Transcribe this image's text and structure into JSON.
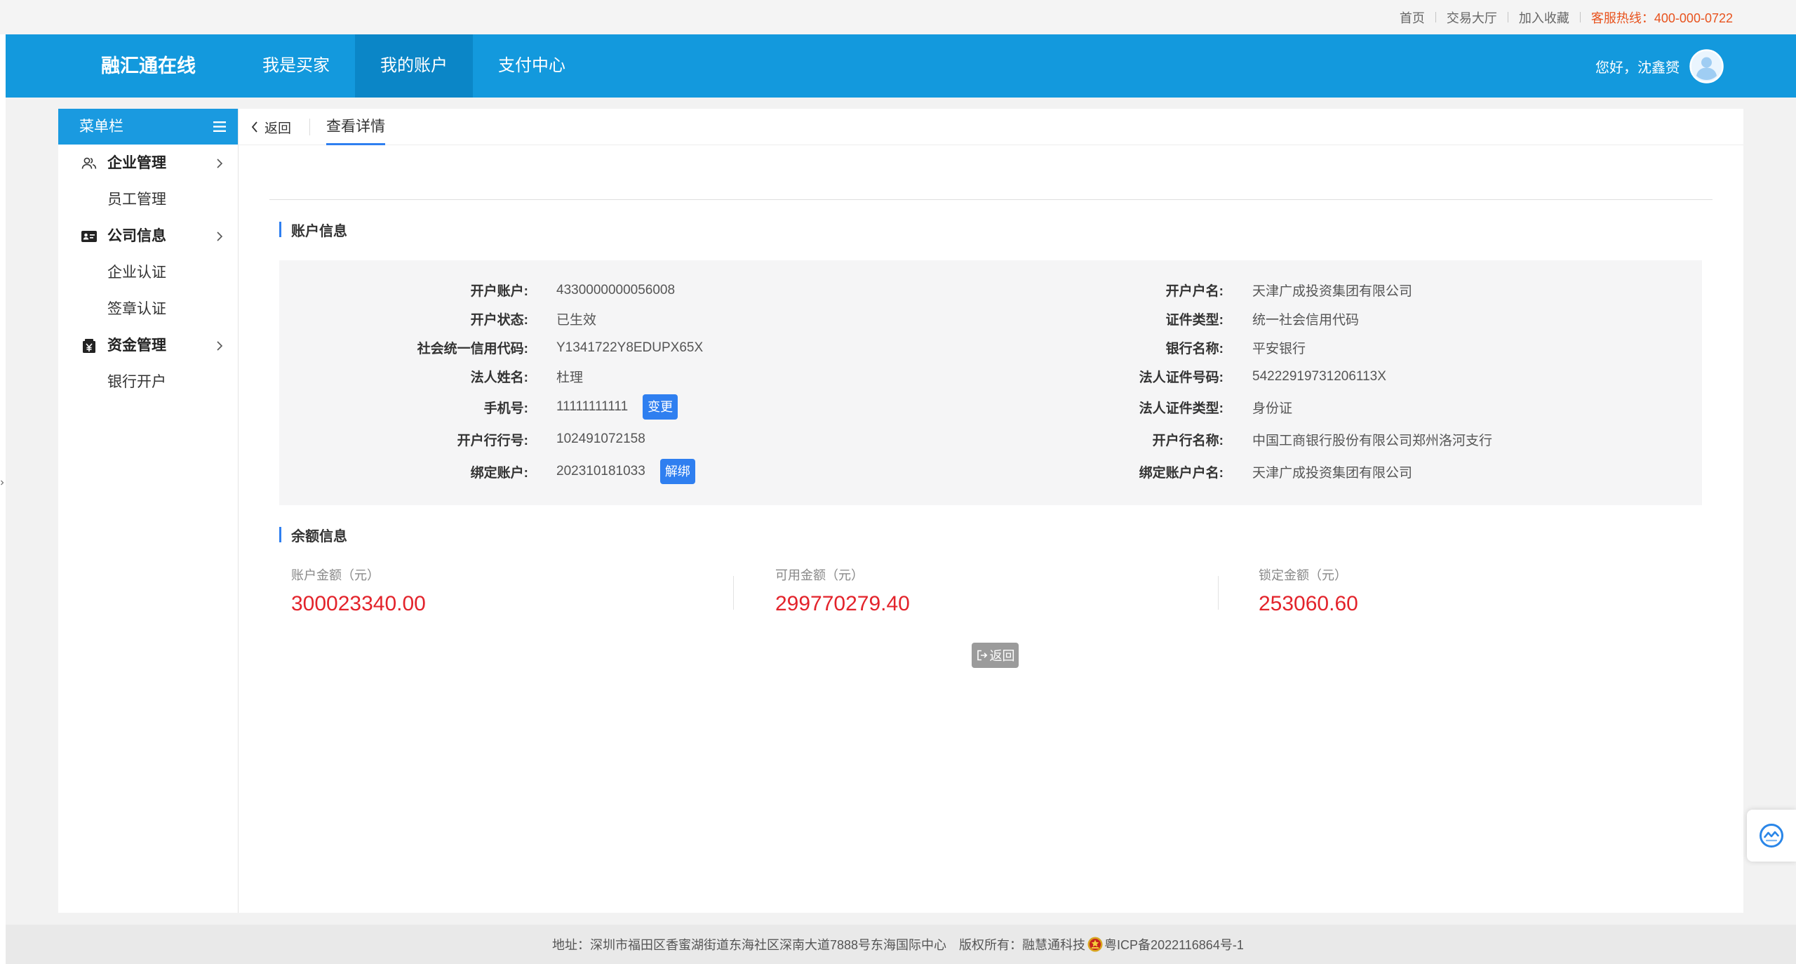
{
  "topbar": {
    "links": [
      {
        "label": "首页"
      },
      {
        "label": "交易大厅"
      },
      {
        "label": "加入收藏"
      }
    ],
    "hotline": "客服热线：400-000-0722"
  },
  "header": {
    "logo": "融汇通在线",
    "nav": [
      {
        "label": "我是买家",
        "active": false
      },
      {
        "label": "我的账户",
        "active": true
      },
      {
        "label": "支付中心",
        "active": false
      }
    ],
    "greeting": "您好，沈鑫赟",
    "avatar_icon": "user-avatar-icon"
  },
  "sidebar": {
    "title": "菜单栏",
    "menu_icon": "hamburger-menu-icon",
    "groups": [
      {
        "label": "企业管理",
        "icon": "users-icon",
        "items": [
          "员工管理"
        ]
      },
      {
        "label": "公司信息",
        "icon": "id-card-icon",
        "items": [
          "企业认证",
          "签章认证"
        ]
      },
      {
        "label": "资金管理",
        "icon": "yen-icon",
        "items": [
          "银行开户"
        ]
      }
    ]
  },
  "tabs": {
    "back": "返回",
    "current": "查看详情"
  },
  "account": {
    "title": "账户信息",
    "change_button": "变更",
    "unbind_button": "解绑",
    "rows": [
      {
        "left": {
          "label": "开户账户:",
          "value": "4330000000056008"
        },
        "right": {
          "label": "开户户名:",
          "value": "天津广成投资集团有限公司"
        }
      },
      {
        "left": {
          "label": "开户状态:",
          "value": "已生效"
        },
        "right": {
          "label": "证件类型:",
          "value": "统一社会信用代码"
        }
      },
      {
        "left": {
          "label": "社会统一信用代码:",
          "value": "Y1341722Y8EDUPX65X"
        },
        "right": {
          "label": "银行名称:",
          "value": "平安银行"
        }
      },
      {
        "left": {
          "label": "法人姓名:",
          "value": "杜理"
        },
        "right": {
          "label": "法人证件号码:",
          "value": "54222919731206113X"
        }
      },
      {
        "left": {
          "label": "手机号:",
          "value": "11111111111"
        },
        "right": {
          "label": "法人证件类型:",
          "value": "身份证"
        }
      },
      {
        "left": {
          "label": "开户行行号:",
          "value": "102491072158"
        },
        "right": {
          "label": "开户行名称:",
          "value": "中国工商银行股份有限公司郑州洛河支行"
        }
      },
      {
        "left": {
          "label": "绑定账户:",
          "value": "202310181033"
        },
        "right": {
          "label": "绑定账户户名:",
          "value": "天津广成投资集团有限公司"
        }
      }
    ]
  },
  "balance": {
    "title": "余额信息",
    "items": [
      {
        "label": "账户金额（元）",
        "value": "300023340.00"
      },
      {
        "label": "可用金额（元）",
        "value": "299770279.40"
      },
      {
        "label": "锁定金额（元）",
        "value": "253060.60"
      }
    ]
  },
  "return_button": {
    "label": "返回",
    "icon": "exit-icon"
  },
  "footer": {
    "address": "地址：深圳市福田区香蜜湖街道东海社区深南大道7888号东海国际中心",
    "copyright": "版权所有：融慧通科技",
    "badge_icon": "police-badge-icon",
    "icp": "粤ICP备2022116864号-1"
  },
  "float_widget_icon": "support-widget-icon",
  "colors": {
    "header_blue": "#1399dd",
    "active_nav": "#0b86c7",
    "accent_blue": "#2f7ff0",
    "amount_red": "#e3232b",
    "hotline_orange": "#e8531e",
    "return_grey": "#9b9b9b"
  }
}
